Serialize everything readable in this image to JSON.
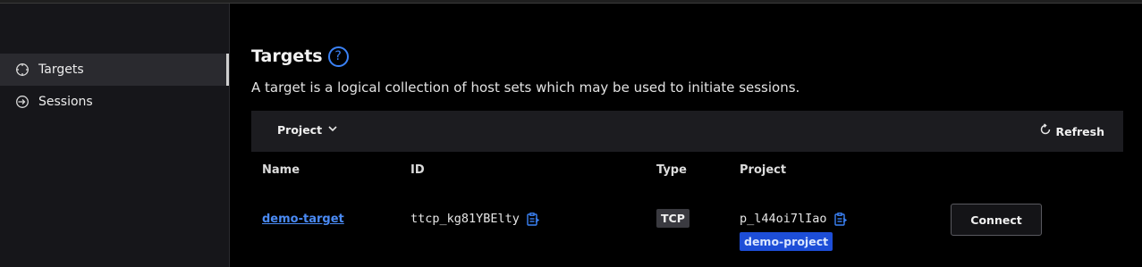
{
  "sidebar": {
    "items": [
      {
        "label": "Targets",
        "icon": "crosshair-icon",
        "active": true
      },
      {
        "label": "Sessions",
        "icon": "sign-in-icon",
        "active": false
      }
    ]
  },
  "main": {
    "title": "Targets",
    "help_icon": "?",
    "description": "A target is a logical collection of host sets which may be used to initiate sessions.",
    "toolbar": {
      "project_filter_label": "Project",
      "refresh_label": "Refresh"
    },
    "table": {
      "columns": [
        "Name",
        "ID",
        "Type",
        "Project"
      ],
      "rows": [
        {
          "name": "demo-target",
          "id": "ttcp_kg81YBElty",
          "type": "TCP",
          "project_id": "p_l44oi7lIao",
          "project_name": "demo-project",
          "action_label": "Connect"
        }
      ]
    }
  },
  "colors": {
    "accent": "#3b82f6",
    "project_badge": "#1d4ed8",
    "sidebar_bg": "#16161a"
  }
}
